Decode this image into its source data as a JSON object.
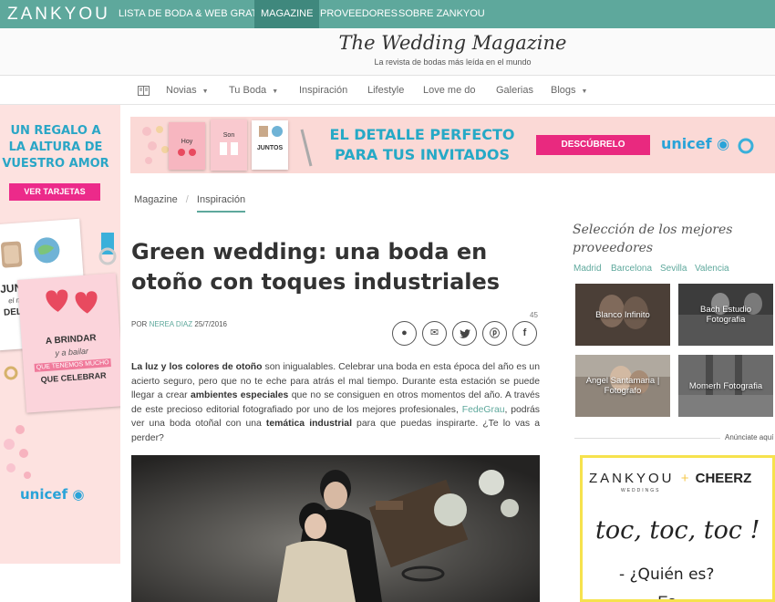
{
  "brand": {
    "logo": "ZANKYOU"
  },
  "topnav": [
    {
      "label": "LISTA DE BODA & WEB GRATIS"
    },
    {
      "label": "MAGAZINE"
    },
    {
      "label": "PROVEEDORES"
    },
    {
      "label": "SOBRE ZANKYOU"
    }
  ],
  "header": {
    "title": "The Wedding Magazine",
    "subtitle": "La revista de bodas más leída en el mundo"
  },
  "subnav": [
    {
      "label": "Novias"
    },
    {
      "label": "Tu Boda"
    },
    {
      "label": "Inspiración"
    },
    {
      "label": "Lifestyle"
    },
    {
      "label": "Love me do"
    },
    {
      "label": "Galerias"
    },
    {
      "label": "Blogs"
    }
  ],
  "left_ad": {
    "line1": "UN REGALO A",
    "line2": "LA ALTURA DE",
    "line3": "VUESTRO AMOR",
    "button": "VER TARJETAS",
    "card1": "JUNTOS",
    "card1_sub": "el mejor lugar",
    "card1_end": "DEL MUNDO",
    "card2_l1": "A BRINDAR",
    "card2_l2": "y a bailar",
    "card2_l3": "QUE TENEMOS MUCHO",
    "card2_l4": "QUE CELEBRAR",
    "unicef": "unicef"
  },
  "top_banner": {
    "line1": "EL DETALLE PERFECTO",
    "line2": "PARA TUS INVITADOS",
    "button": "DESCÚBRELO",
    "unicef": "unicef",
    "card_a": "Hoy",
    "card_b": "Son",
    "card_c": "JUNTOS"
  },
  "breadcrumb": {
    "root": "Magazine",
    "sep": "/",
    "current": "Inspiración"
  },
  "article": {
    "title": "Green wedding: una boda en otoño con toques industriales",
    "byline_prefix": "POR",
    "author": "NEREA DIAZ",
    "date": "25/7/2016",
    "share_count": "45",
    "body": {
      "b1": "La luz y los colores de otoño",
      "t1": " son inigualables. Celebrar una boda en esta época del año es un acierto seguro, pero que no te eche para atrás el mal tiempo. Durante esta estación se puede llegar a crear ",
      "b2": "ambientes especiales",
      "t2": " que no se consiguen en otros momentos del año. A través de este precioso editorial fotografiado por uno de los mejores profesionales, ",
      "link": "FedeGrau",
      "t3": ", podrás ver una boda otoñal con una ",
      "b3": "temática industrial",
      "t4": " para que puedas inspirarte. ¿Te lo vas a perder?"
    }
  },
  "sidebar": {
    "title": "Selección de los mejores proveedores",
    "cities": [
      "Madrid",
      "Barcelona",
      "Sevilla",
      "Valencia"
    ],
    "tiles": [
      {
        "label": "Blanco Infinito"
      },
      {
        "label": "Bach Estudio Fotografia"
      },
      {
        "label": "Angel Santamaria | Fotografo"
      },
      {
        "label": "Momerh Fotografia"
      }
    ],
    "annonce": "Anúnciate aquí",
    "ad": {
      "brand_left": "ZANKYOU",
      "brand_small": "WEDDINGS",
      "plus": "+",
      "brand_right": "CHEERZ",
      "toc": "toc, toc, toc !",
      "quien": "- ¿Quién es?",
      "more": "- Es..."
    }
  },
  "colors": {
    "accent": "#5ea89c",
    "pink": "#e9297f",
    "blue": "#26a9c6"
  }
}
